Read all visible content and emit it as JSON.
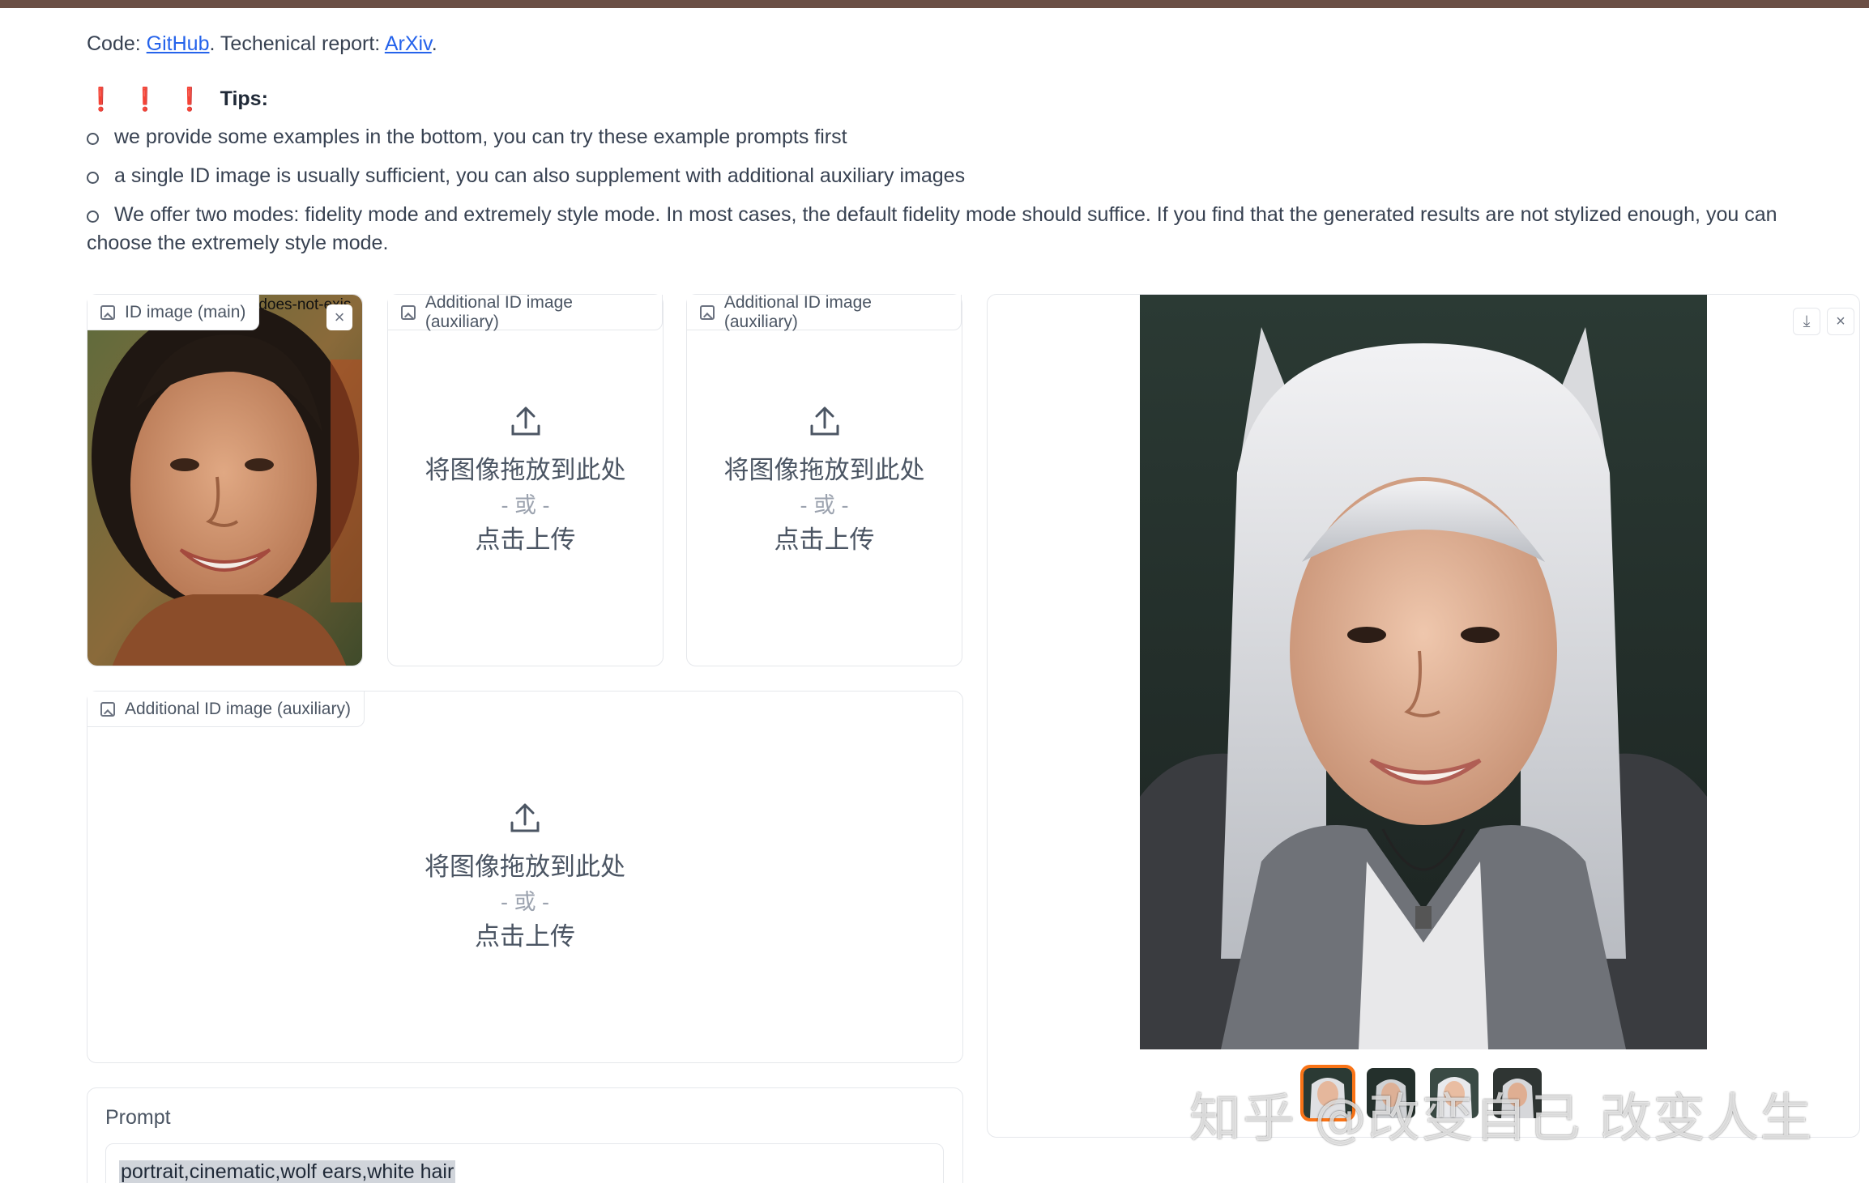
{
  "header": {
    "code_prefix": "Code: ",
    "github_link": "GitHub",
    "report_prefix": ". Techenical report: ",
    "arxiv_link": "ArXiv",
    "suffix": "."
  },
  "tips": {
    "marks": "❗",
    "title": "Tips:",
    "items": [
      "we provide some examples in the bottom, you can try these example prompts first",
      "a single ID image is usually sufficient, you can also supplement with additional auxiliary images",
      "We offer two modes: fidelity mode and extremely style mode. In most cases, the default fidelity mode should suffice. If you find that the generated results are not stylized enough, you can choose the extremely style mode."
    ]
  },
  "id_main": {
    "label": "ID image (main)",
    "broken_text": "-does-not-exis",
    "clear_icon": "×"
  },
  "uploads": [
    {
      "label": "Additional ID image (auxiliary)",
      "line1": "将图像拖放到此处",
      "or": "- 或 -",
      "line2": "点击上传"
    },
    {
      "label": "Additional ID image (auxiliary)",
      "line1": "将图像拖放到此处",
      "or": "- 或 -",
      "line2": "点击上传"
    },
    {
      "label": "Additional ID image (auxiliary)",
      "line1": "将图像拖放到此处",
      "or": "- 或 -",
      "line2": "点击上传"
    }
  ],
  "output": {
    "download_icon": "⤓",
    "close_icon": "×"
  },
  "watermark": "知乎 @改变自己 改变人生",
  "prompt": {
    "label": "Prompt",
    "value": "portrait,cinematic,wolf ears,white hair"
  },
  "colors": {
    "accent": "#f97316",
    "link": "#2563eb",
    "alert": "#e02424",
    "topbar": "#6b4f45"
  }
}
